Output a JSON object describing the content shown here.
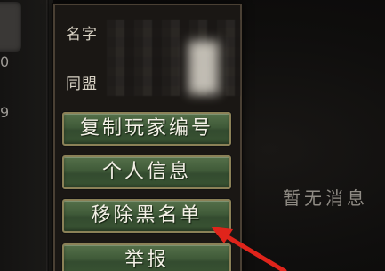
{
  "left_panel": {
    "digits": [
      "0",
      "9"
    ]
  },
  "popup": {
    "name_label": "名字",
    "server_label": "同盟",
    "buttons": [
      {
        "label": "复制玩家编号"
      },
      {
        "label": "个人信息"
      },
      {
        "label": "移除黑名单"
      },
      {
        "label": "举报"
      }
    ]
  },
  "message_area": {
    "empty_text": "暂无消息"
  },
  "colors": {
    "button_green": "#3f5a38",
    "button_border": "#8b8157",
    "arrow_red": "#e0241b"
  }
}
